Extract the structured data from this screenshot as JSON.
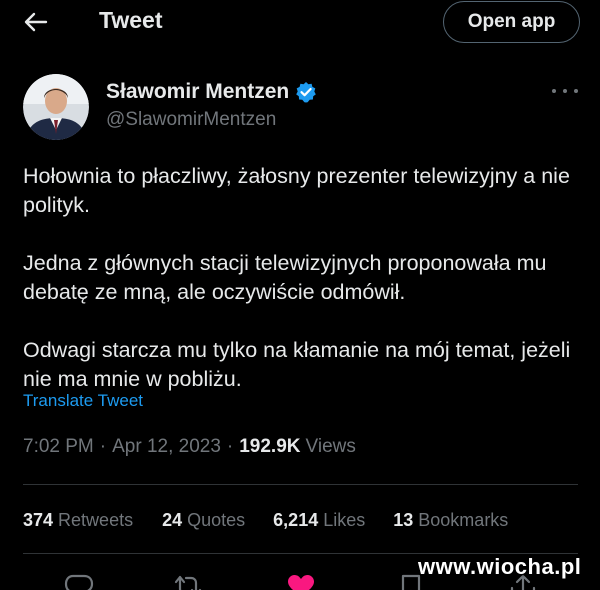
{
  "header": {
    "title": "Tweet",
    "open_app_label": "Open app"
  },
  "author": {
    "name": "Sławomir Mentzen",
    "handle": "@SlawomirMentzen",
    "verified": true
  },
  "tweet": {
    "paragraphs": [
      "Hołownia to płaczliwy, żałosny prezenter telewizyjny a nie polityk.",
      "Jedna z głównych stacji telewizyjnych proponowała mu debatę ze mną, ale oczywiście odmówił.",
      "Odwagi starcza mu tylko na kłamanie na mój temat, jeżeli nie ma mnie w pobliżu."
    ],
    "translate_label": "Translate Tweet",
    "time": "7:02 PM",
    "date": "Apr 12, 2023",
    "views_count": "192.9K",
    "views_label": "Views"
  },
  "stats": {
    "retweets_count": "374",
    "retweets_label": "Retweets",
    "quotes_count": "24",
    "quotes_label": "Quotes",
    "likes_count": "6,214",
    "likes_label": "Likes",
    "bookmarks_count": "13",
    "bookmarks_label": "Bookmarks"
  },
  "watermark": "www.wiocha.pl",
  "colors": {
    "background": "#000000",
    "text": "#e7e9ea",
    "muted": "#71767b",
    "link": "#1d9bf0",
    "like": "#f91880",
    "verified": "#1d9bf0"
  },
  "icons": {
    "back": "arrow-left-icon",
    "verified": "verified-badge-icon",
    "more": "more-horizontal-icon",
    "reply": "reply-icon",
    "retweet": "retweet-icon",
    "like": "heart-filled-icon",
    "bookmark": "bookmark-icon",
    "share": "share-icon"
  }
}
